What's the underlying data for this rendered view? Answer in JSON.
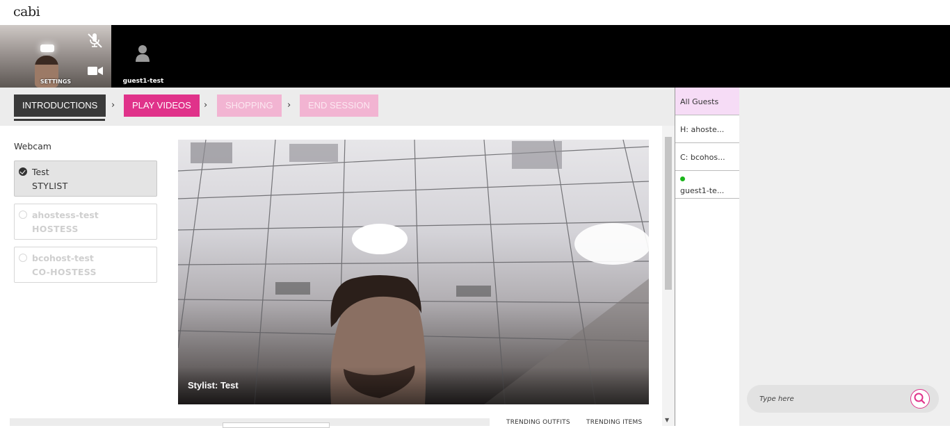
{
  "app": {
    "logo": "cabi"
  },
  "video_strip": {
    "self_label": "SETTINGS",
    "guest_label": "guest1-test"
  },
  "steps": {
    "introductions": "INTRODUCTIONS",
    "play_videos": "PLAY VIDEOS",
    "shopping": "SHOPPING",
    "end_session": "END SESSION",
    "separator": "›"
  },
  "webcam": {
    "label": "Webcam",
    "participants": [
      {
        "name": "Test",
        "role": "STYLIST"
      },
      {
        "name": "ahostess-test",
        "role": "HOSTESS"
      },
      {
        "name": "bcohost-test",
        "role": "CO-HOSTESS"
      }
    ]
  },
  "main_video": {
    "caption": "Stylist: Test"
  },
  "bottom": {
    "trending_outfits": "TRENDING OUTFITS",
    "trending_items": "TRENDING ITEMS"
  },
  "guest_list": {
    "items": [
      "All Guests",
      "H: ahoste...",
      "C: bcohos...",
      "guest1-te..."
    ]
  },
  "chat": {
    "placeholder": "Type here"
  },
  "colors": {
    "accent": "#e0328a",
    "accent_light": "#f2b4d2",
    "active_step": "#3a3a3a",
    "online": "#1bb51b",
    "all_guests_bg": "#f6dcf6"
  },
  "icons": [
    "mic-off-icon",
    "video-camera-icon",
    "user-avatar-icon",
    "checkmark-icon",
    "search-icon",
    "scroll-down-arrow-icon"
  ]
}
